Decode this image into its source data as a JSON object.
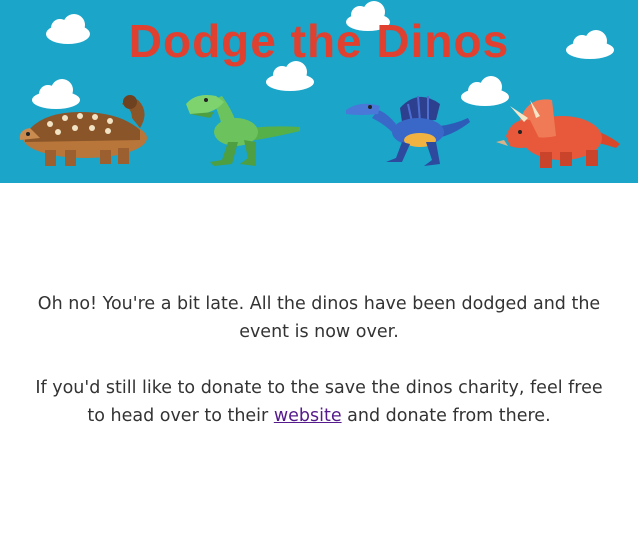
{
  "header": {
    "title": "Dodge the Dinos",
    "background_color": "#1aa5c9",
    "title_color": "#e0402f",
    "illustrations": [
      "cloud-icon",
      "ankylosaurus-icon",
      "t-rex-icon",
      "spinosaurus-icon",
      "triceratops-icon"
    ]
  },
  "message": {
    "line1": "Oh no! You're a bit late. All the dinos have been dodged and the event is now over.",
    "line2_before": "If you'd still like to donate to the save the dinos charity, feel free to head over to their ",
    "link_text": "website",
    "line2_after": " and donate from there.",
    "link_color": "#551a8b"
  }
}
